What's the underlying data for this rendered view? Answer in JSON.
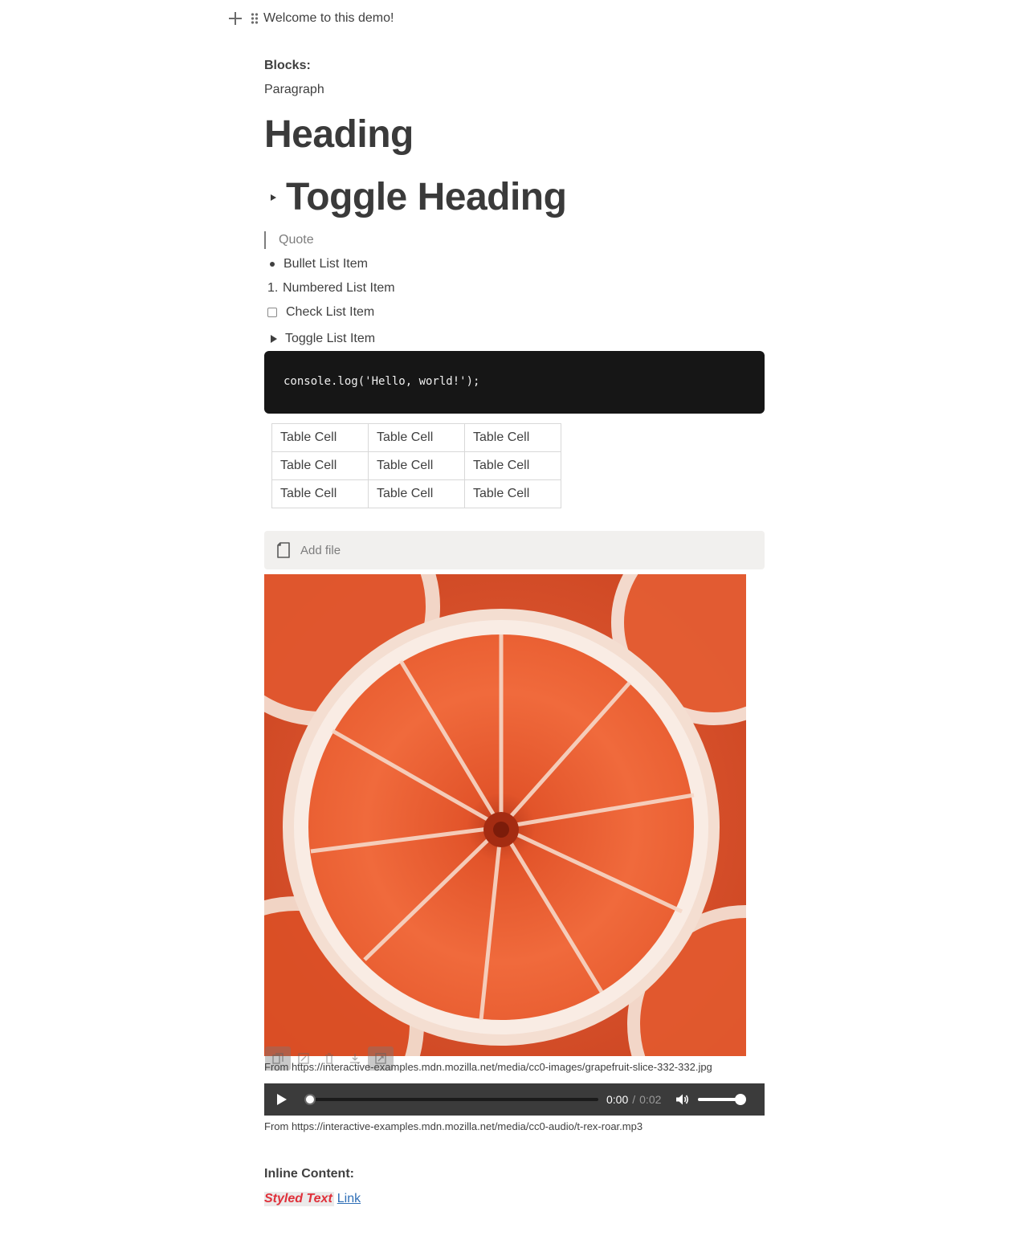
{
  "header": {
    "title": "Welcome to this demo!",
    "plus_icon": "plus-icon",
    "drag_icon": "drag-handle-icon"
  },
  "blocks": {
    "label": "Blocks:",
    "paragraph": "Paragraph",
    "heading": "Heading",
    "toggle_heading": "Toggle Heading",
    "quote": "Quote",
    "bullet_item": "Bullet List Item",
    "numbered_marker": "1.",
    "numbered_item": "Numbered List Item",
    "check_item": "Check List Item",
    "check_item_checked": false,
    "toggle_item": "Toggle List Item",
    "code": "console.log('Hello, world!');",
    "table": [
      [
        "Table Cell",
        "Table Cell",
        "Table Cell"
      ],
      [
        "Table Cell",
        "Table Cell",
        "Table Cell"
      ],
      [
        "Table Cell",
        "Table Cell",
        "Table Cell"
      ]
    ],
    "file_label": "Add file",
    "image_caption": "From https://interactive-examples.mdn.mozilla.net/media/cc0-images/grapefruit-slice-332-332.jpg",
    "image_tools": [
      "copy-icon",
      "edit-icon",
      "delete-icon",
      "download-icon",
      "fullscreen-icon"
    ],
    "audio": {
      "current_time": "0:00",
      "separator": "/",
      "duration": "0:02",
      "progress": 0,
      "volume": 1
    },
    "audio_caption": "From https://interactive-examples.mdn.mozilla.net/media/cc0-audio/t-rex-roar.mp3"
  },
  "inline": {
    "label": "Inline Content:",
    "styled_text": "Styled Text",
    "link_text": "Link"
  },
  "colors": {
    "text": "#3f3f3f",
    "code_bg": "#161616",
    "file_bg": "#f1f0ee",
    "styled_text": "#e0303a",
    "link": "#2f6fb7",
    "audio_bg": "#3b3b3b"
  }
}
